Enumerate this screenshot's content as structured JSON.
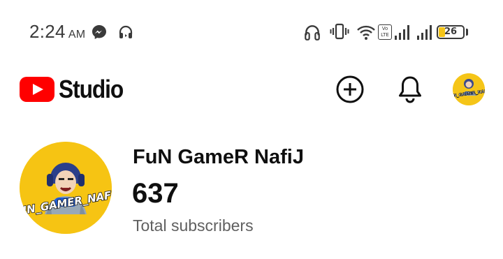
{
  "status_bar": {
    "time": "2:24",
    "ampm": "AM",
    "icons": [
      "messenger-icon",
      "headphones-icon",
      "vibrate-icon",
      "wifi-icon",
      "volte-icon",
      "signal-icon",
      "battery-icon"
    ],
    "volte_top": "Vo",
    "volte_bottom": "LTE",
    "battery_level": "26",
    "battery_color": "#f5c518"
  },
  "header": {
    "logo_text": "Studio",
    "brand_color": "#ff0000",
    "create_icon": "plus-circle-icon",
    "notifications_icon": "bell-icon",
    "avatar_text": "FUN_GAMER_NAFIJ"
  },
  "channel": {
    "name": "FuN GameR NafiJ",
    "subscriber_count": "637",
    "subscriber_label": "Total subscribers",
    "avatar_text": "FUN_GAMER_NAFIJ",
    "avatar_color": "#f6c413"
  }
}
